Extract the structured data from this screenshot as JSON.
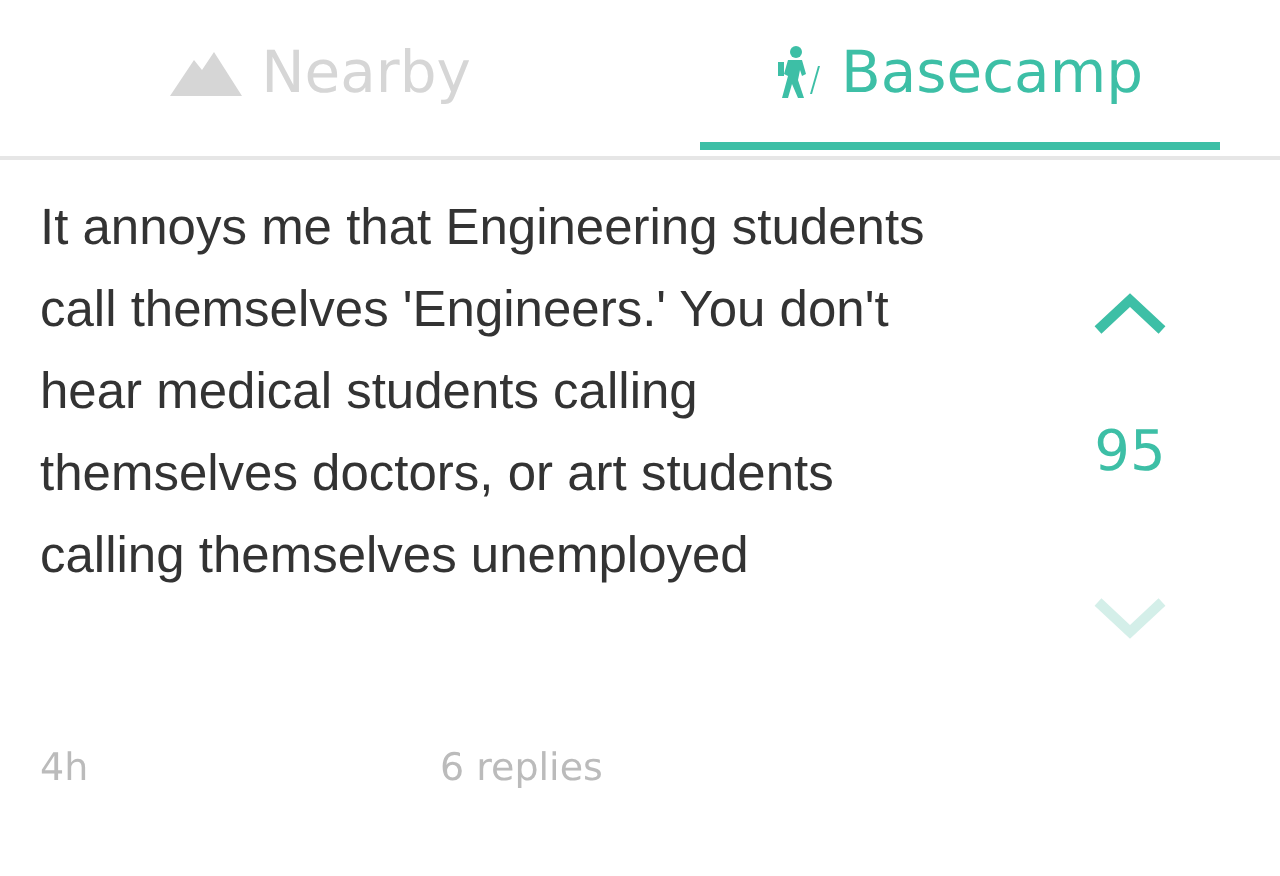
{
  "tabs": [
    {
      "label": "Nearby",
      "selected": false
    },
    {
      "label": "Basecamp",
      "selected": true
    }
  ],
  "post": {
    "text": "It annoys me that Engineering students call themselves 'Engineers.' You don't hear medical students calling themselves doctors, or art students calling themselves unemployed",
    "score": "95",
    "upvoted": true,
    "age": "4h",
    "replies": "6 replies"
  }
}
